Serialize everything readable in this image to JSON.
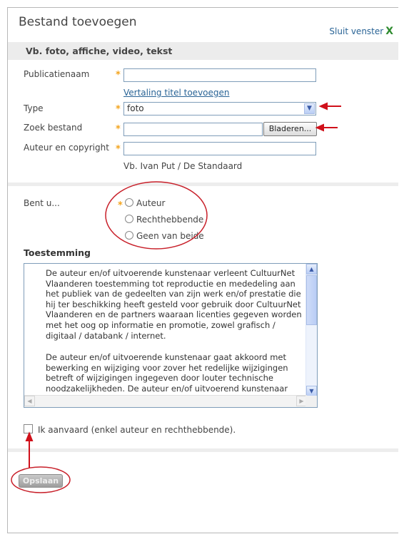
{
  "dialog": {
    "title": "Bestand toevoegen",
    "close_label": "Sluit venster",
    "close_icon": "X",
    "subtitle": "Vb. foto, affiche, video, tekst"
  },
  "form": {
    "publication_label": "Publicatienaam",
    "publication_value": "",
    "translate_link": "Vertaling titel toevoegen",
    "type_label": "Type",
    "type_value": "foto",
    "file_label": "Zoek bestand",
    "file_value": "",
    "browse_label": "Bladeren...",
    "author_label": "Auteur en copyright",
    "author_value": "",
    "author_hint": "Vb. Ivan Put / De Standaard",
    "required_marker": "*"
  },
  "role": {
    "label": "Bent u...",
    "options": [
      "Auteur",
      "Rechthebbende",
      "Geen van beide"
    ]
  },
  "consent": {
    "heading": "Toestemming",
    "paragraphs": [
      "De auteur en/of uitvoerende kunstenaar verleent CultuurNet Vlaanderen toestemming tot reproductie en mededeling aan het publiek van de gedeelten van zijn werk en/of prestatie die hij ter beschikking heeft gesteld voor gebruik door CultuurNet Vlaanderen en de partners waaraan licenties gegeven worden met het oog op informatie en promotie, zowel grafisch / digitaal / databank / internet.",
      "De auteur en/of uitvoerende kunstenaar gaat akkoord met bewerking en wijziging voor zover het redelijke wijzigingen betreft of wijzigingen ingegeven door louter technische noodzakelijkheden. De auteur en/of uitvoerend kunstenaar"
    ],
    "accept_label": "Ik aanvaard (enkel auteur en rechthebbende).",
    "accept_checked": false
  },
  "actions": {
    "save_label": "Opslaan"
  },
  "colors": {
    "accent_link": "#2a6496",
    "required_star": "#f3a41e",
    "annotation_red": "#d0101a"
  }
}
